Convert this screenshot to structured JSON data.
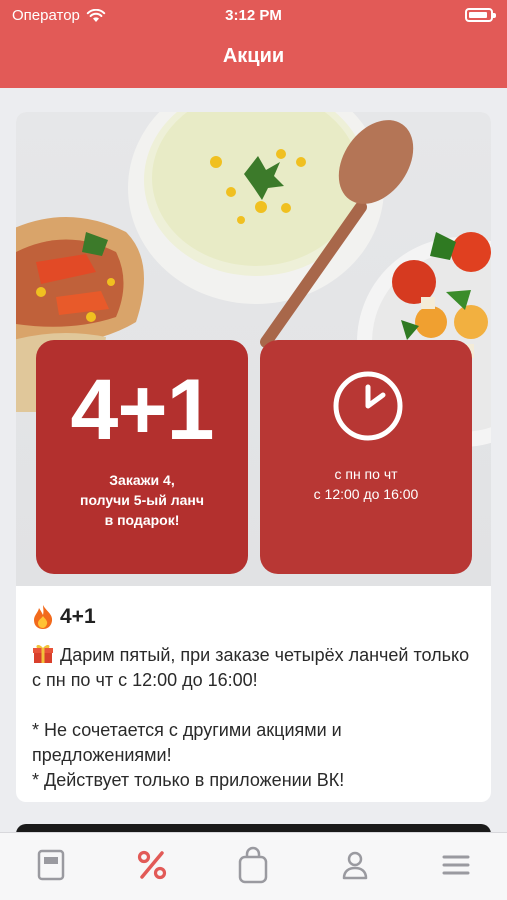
{
  "status_bar": {
    "carrier": "Оператор",
    "time": "3:12 PM"
  },
  "header": {
    "title": "Акции"
  },
  "promo": {
    "tile_left": {
      "big": "4+1",
      "lines": [
        "Закажи 4,",
        "получи 5-ый ланч",
        "в подарок!"
      ]
    },
    "tile_right": {
      "lines": [
        "с пн по чт",
        "с 12:00 до 16:00"
      ],
      "icon": "clock-icon"
    },
    "title": "4+1",
    "title_icon": "fire-icon",
    "body_icon": "gift-icon",
    "body": "Дарим пятый, при заказе четырёх ланчей только с пн по чт с 12:00 до 16:00!",
    "note1": "* Не сочетается с другими акциями и предложениями!",
    "note2": "* Действует только в приложении ВК!"
  },
  "tabbar": {
    "items": [
      {
        "name": "menu",
        "icon": "menu-book-icon",
        "active": false
      },
      {
        "name": "promotions",
        "icon": "percent-icon",
        "active": true
      },
      {
        "name": "cart",
        "icon": "shopping-bag-icon",
        "active": false
      },
      {
        "name": "profile",
        "icon": "person-icon",
        "active": false
      },
      {
        "name": "more",
        "icon": "hamburger-icon",
        "active": false
      }
    ]
  },
  "colors": {
    "header": "#e25a57",
    "tile_left": "#b3302e",
    "tile_right": "#b83734",
    "tab_active": "#e25a57",
    "tab_inactive": "#9a9aa0"
  }
}
